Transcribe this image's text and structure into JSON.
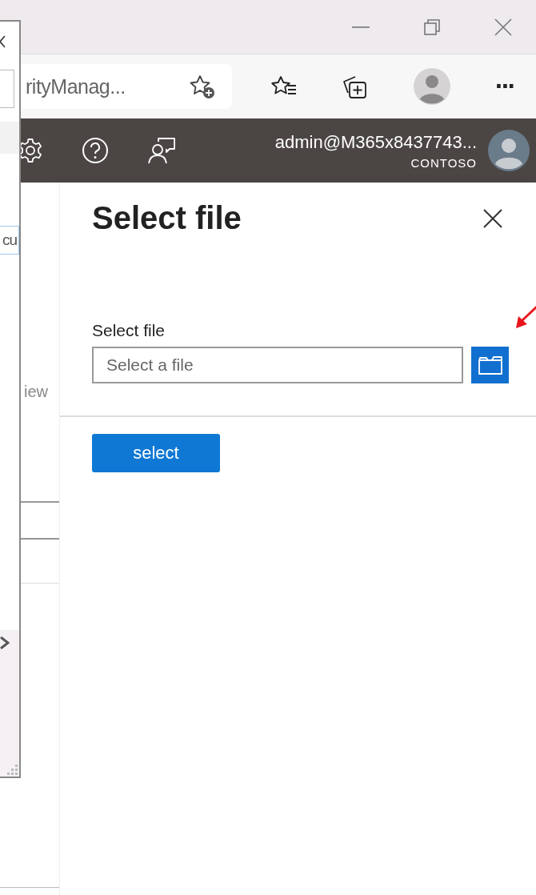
{
  "browser": {
    "address_text": "rityManag...",
    "more_label": "···"
  },
  "app_header": {
    "user": "admin@M365x8437743...",
    "organization": "CONTOSO"
  },
  "background_page": {
    "partial_label": "iew"
  },
  "left_window": {
    "partial_field_text": "cu"
  },
  "panel": {
    "title": "Select file",
    "field_label": "Select file",
    "placeholder": "Select a file",
    "button": "select"
  }
}
